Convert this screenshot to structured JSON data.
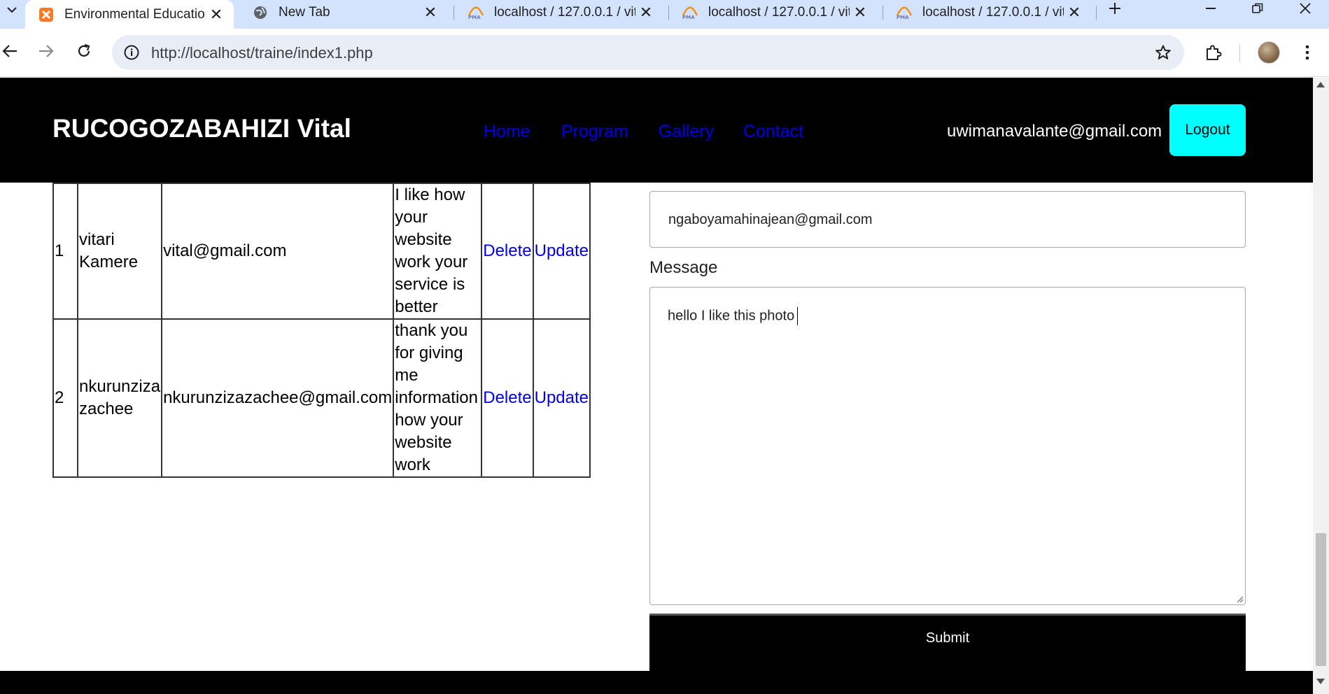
{
  "browser": {
    "tabs": [
      {
        "title": "Environmental Education",
        "icon": "xampp-icon",
        "active": true
      },
      {
        "title": "New Tab",
        "icon": "globe-icon",
        "active": false
      },
      {
        "title": "localhost / 127.0.0.1 / vit",
        "icon": "phpmyadmin-icon",
        "active": false
      },
      {
        "title": "localhost / 127.0.0.1 / vit",
        "icon": "phpmyadmin-icon",
        "active": false
      },
      {
        "title": "localhost / 127.0.0.1 / vit",
        "icon": "phpmyadmin-icon",
        "active": false
      }
    ],
    "url": "http://localhost/traine/index1.php"
  },
  "header": {
    "brand": "RUCOGOZABAHIZI Vital",
    "nav": [
      "Home",
      "Program",
      "Gallery",
      "Contact"
    ],
    "user_email": "uwimanavalante@gmail.com",
    "logout_label": "Logout"
  },
  "feedback": {
    "rows": [
      {
        "id": "1",
        "name_lines": [
          "vitari",
          "Kamere"
        ],
        "email": "vital@gmail.com",
        "message_lines": [
          "I like how",
          "your",
          "website",
          "work your",
          "service is",
          "better"
        ],
        "delete_label": "Delete",
        "update_label": "Update"
      },
      {
        "id": "2",
        "name_lines": [
          "nkurunziza",
          "zachee"
        ],
        "email": "nkurunzizazachee@gmail.com",
        "message_lines": [
          "thank you",
          "for giving",
          "me",
          "information",
          "how your",
          "website",
          "work"
        ],
        "delete_label": "Delete",
        "update_label": "Update"
      }
    ]
  },
  "form": {
    "email_value": "ngaboyamahinajean@gmail.com",
    "message_label": "Message",
    "message_value": "hello I like this photo",
    "submit_label": "Submit"
  },
  "colors": {
    "header_bg": "#000000",
    "logout_bg": "#00ffff",
    "link": "#0000ee",
    "tabstrip_bg": "#d3e3fd"
  }
}
